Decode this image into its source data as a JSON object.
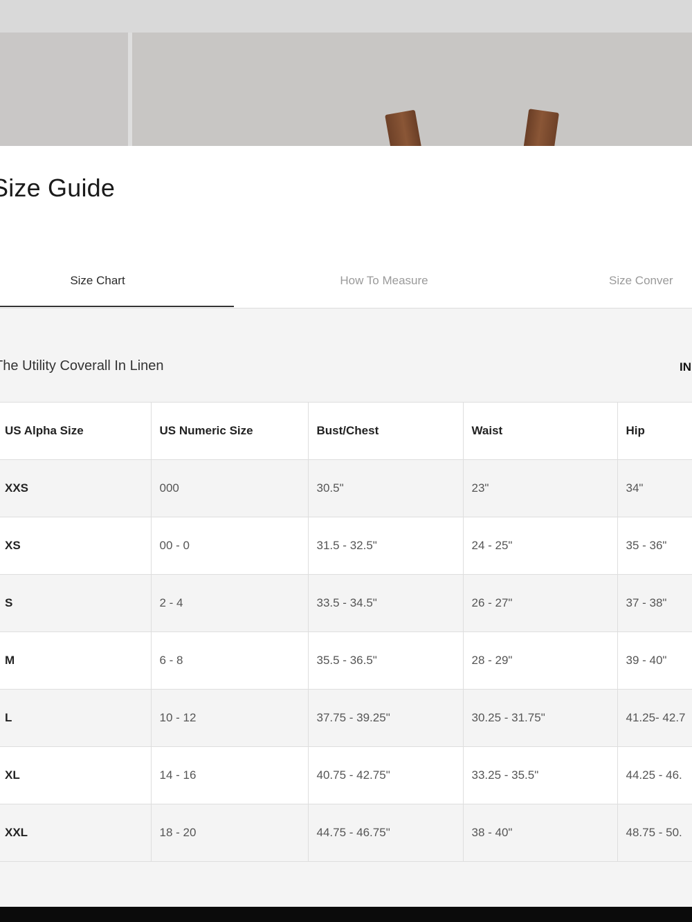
{
  "modal": {
    "title": "Size Guide",
    "tabs": [
      {
        "label": "Size Chart",
        "active": true
      },
      {
        "label": "How To Measure",
        "active": false
      },
      {
        "label": "Size Conver",
        "active": false
      }
    ]
  },
  "chart": {
    "product_name": "The Utility Coverall In Linen",
    "unit_toggle": "IN",
    "columns": [
      "US Alpha Size",
      "US Numeric Size",
      "Bust/Chest",
      "Waist",
      "Hip"
    ],
    "rows": [
      [
        "XXS",
        "000",
        "30.5\"",
        "23\"",
        "34\""
      ],
      [
        "XS",
        "00 - 0",
        "31.5 - 32.5\"",
        "24 - 25\"",
        "35 - 36\""
      ],
      [
        "S",
        "2 - 4",
        "33.5 - 34.5\"",
        "26 - 27\"",
        "37 - 38\""
      ],
      [
        "M",
        "6 - 8",
        "35.5 - 36.5\"",
        "28 - 29\"",
        "39 - 40\""
      ],
      [
        "L",
        "10 - 12",
        "37.75 - 39.25\"",
        "30.25 - 31.75\"",
        "41.25- 42.7"
      ],
      [
        "XL",
        "14 - 16",
        "40.75 - 42.75\"",
        "33.25 - 35.5\"",
        "44.25 - 46."
      ],
      [
        "XXL",
        "18 - 20",
        "44.75 - 46.75\"",
        "38 - 40\"",
        "48.75 - 50."
      ]
    ]
  },
  "colors": {
    "panel_bg": "#ffffff",
    "content_bg": "#f4f4f4",
    "strap": "#7a4a2e"
  }
}
